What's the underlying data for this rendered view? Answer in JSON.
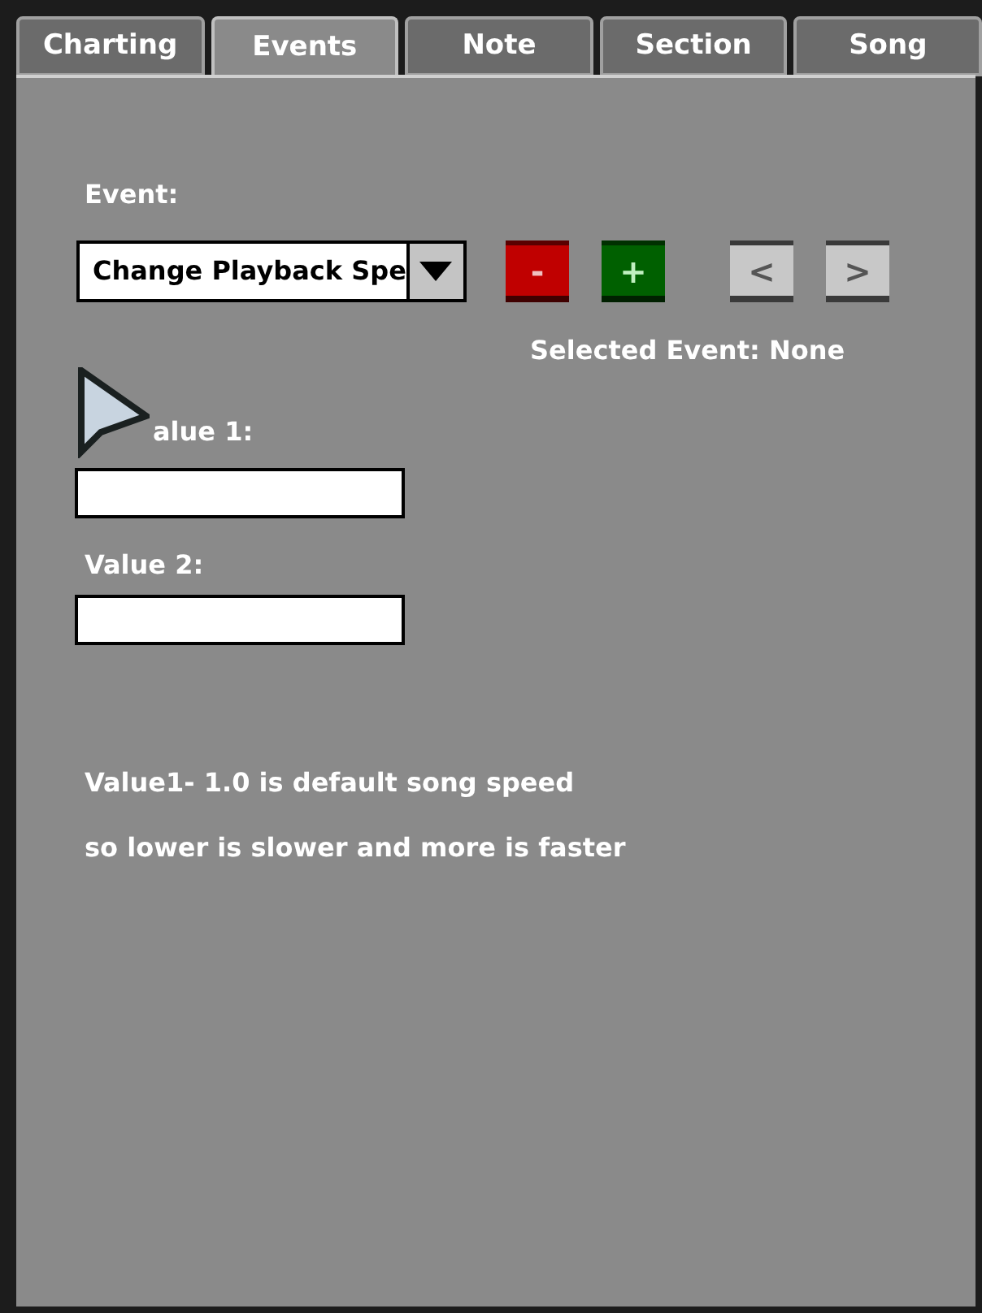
{
  "tabs": [
    {
      "label": "Charting",
      "selected": false
    },
    {
      "label": "Events",
      "selected": true
    },
    {
      "label": "Note",
      "selected": false
    },
    {
      "label": "Section",
      "selected": false
    },
    {
      "label": "Song",
      "selected": false
    }
  ],
  "event_label": "Event:",
  "event_dropdown": {
    "value": "Change Playback Spe"
  },
  "buttons": [
    {
      "kind": "remove",
      "label": "-"
    },
    {
      "kind": "add",
      "label": "+"
    },
    {
      "kind": "prev",
      "label": "<"
    },
    {
      "kind": "next",
      "label": ">"
    }
  ],
  "selected_event": "Selected Event: None",
  "value1": {
    "label": "alue 1:"
  },
  "value2": {
    "label": "Value 2:"
  },
  "description": [
    "Value1- 1.0 is default song speed",
    "so lower is slower and more is faster"
  ]
}
